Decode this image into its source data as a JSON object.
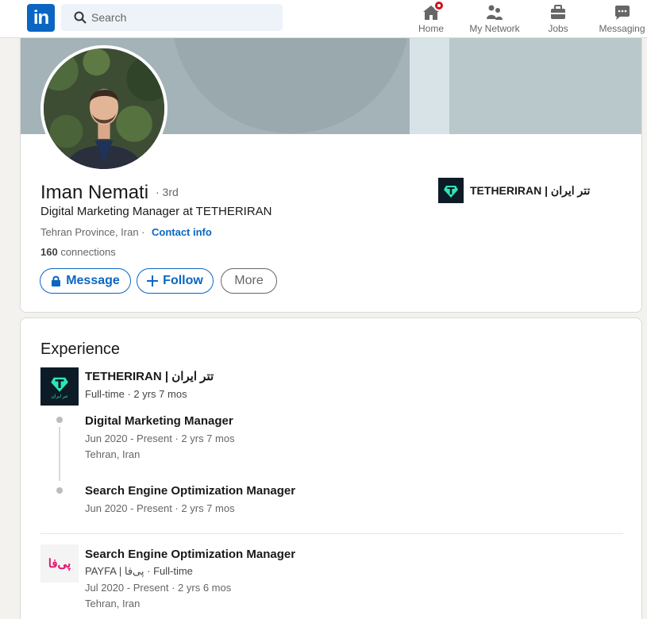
{
  "nav": {
    "logo_text": "in",
    "search_placeholder": "Search",
    "items": [
      {
        "label": "Home",
        "icon": "home-icon",
        "badge": true
      },
      {
        "label": "My Network",
        "icon": "network-icon"
      },
      {
        "label": "Jobs",
        "icon": "jobs-icon"
      },
      {
        "label": "Messaging",
        "icon": "messaging-icon"
      }
    ]
  },
  "profile": {
    "name": "Iman Nemati",
    "degree": "· 3rd",
    "headline": "Digital Marketing Manager at TETHERIRAN",
    "location": "Tehran Province, Iran ·",
    "contact_label": "Contact info",
    "connections_count": "160",
    "connections_label": "connections",
    "buttons": {
      "message": "Message",
      "follow": "Follow",
      "more": "More"
    },
    "current_company": "TETHERIRAN | تتر ایران"
  },
  "experience": {
    "title": "Experience",
    "tether": {
      "company": "TETHERIRAN | تتر ایران",
      "summary": "Full-time · 2 yrs 7 mos",
      "logo_caption": "تتر ایران",
      "roles": [
        {
          "title": "Digital Marketing Manager",
          "dates": "Jun 2020 - Present · 2 yrs 7 mos",
          "location": "Tehran, Iran"
        },
        {
          "title": "Search Engine Optimization Manager",
          "dates": "Jun 2020 - Present · 2 yrs 7 mos"
        }
      ]
    },
    "payfa": {
      "logo_text": "پی‌فا",
      "title": "Search Engine Optimization Manager",
      "company": "PAYFA | پی‌فا · Full-time",
      "dates": "Jul 2020 - Present · 2 yrs 6 mos",
      "location": "Tehran, Iran"
    }
  },
  "colors": {
    "brand": "#0a66c2",
    "badge": "#cc1016"
  }
}
